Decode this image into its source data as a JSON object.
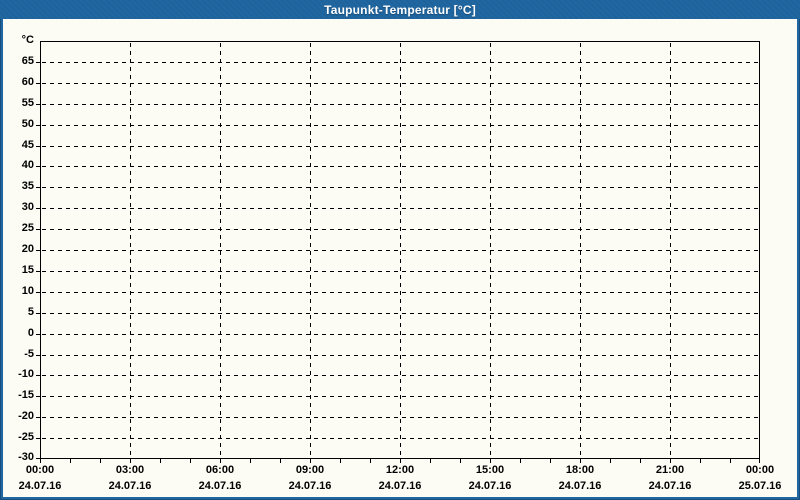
{
  "window": {
    "title": "Taupunkt-Temperatur [°C]"
  },
  "colors": {
    "titlebar_bg": "#2066a0",
    "window_border": "#2066a0",
    "window_outline": "#174f7c",
    "content_bg": "#fcfcf5",
    "axis_color": "#000000",
    "grid_color": "#000000",
    "label_color": "#000000",
    "title_color": "#ffffff"
  },
  "chart_data": {
    "type": "line",
    "title": "Taupunkt-Temperatur [°C]",
    "y_unit_label": "°C",
    "ylim": [
      -30,
      70
    ],
    "ytick_step": 5,
    "yticks": [
      65,
      60,
      55,
      50,
      45,
      40,
      35,
      30,
      25,
      20,
      15,
      10,
      5,
      0,
      -5,
      -10,
      -15,
      -20,
      -25,
      -30
    ],
    "x_hours_span": 24,
    "x_minor_tick_interval_hours": 1,
    "x_major_tick_interval_hours": 3,
    "x_major_ticks": [
      {
        "time": "00:00",
        "date": "24.07.16"
      },
      {
        "time": "03:00",
        "date": "24.07.16"
      },
      {
        "time": "06:00",
        "date": "24.07.16"
      },
      {
        "time": "09:00",
        "date": "24.07.16"
      },
      {
        "time": "12:00",
        "date": "24.07.16"
      },
      {
        "time": "15:00",
        "date": "24.07.16"
      },
      {
        "time": "18:00",
        "date": "24.07.16"
      },
      {
        "time": "21:00",
        "date": "24.07.16"
      },
      {
        "time": "00:00",
        "date": "25.07.16"
      }
    ],
    "grid_style": "dashed",
    "legend": null,
    "series": []
  }
}
